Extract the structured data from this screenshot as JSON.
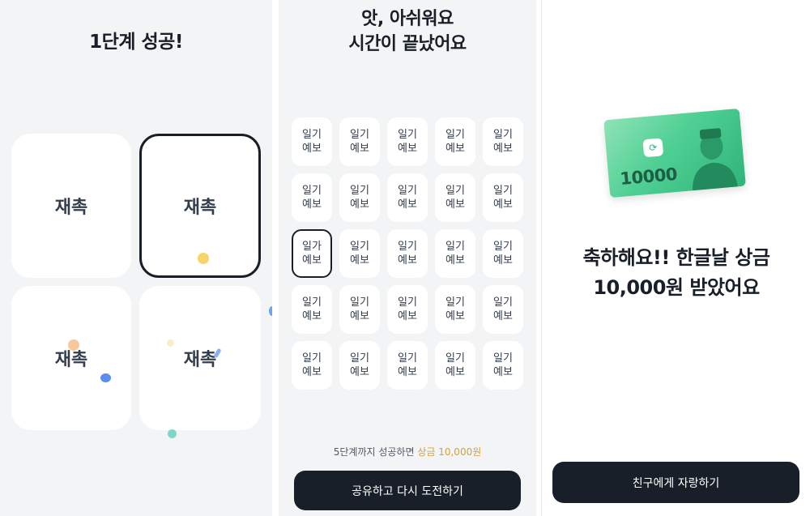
{
  "panel1": {
    "title": "1단계 성공!",
    "cards": [
      "재촉",
      "재촉",
      "재촉",
      "재촉"
    ],
    "selected_index": 1
  },
  "panel2": {
    "title_line1": "앗, 아쉬워요",
    "title_line2": "시간이 끝났어요",
    "grid": [
      [
        "일기",
        "예보"
      ],
      [
        "일기",
        "예보"
      ],
      [
        "일기",
        "예보"
      ],
      [
        "일기",
        "예보"
      ],
      [
        "일기",
        "예보"
      ],
      [
        "일기",
        "예보"
      ],
      [
        "일기",
        "예보"
      ],
      [
        "일기",
        "예보"
      ],
      [
        "일기",
        "예보"
      ],
      [
        "일기",
        "예보"
      ],
      [
        "일가",
        "예보"
      ],
      [
        "일기",
        "예보"
      ],
      [
        "일기",
        "예보"
      ],
      [
        "일기",
        "예보"
      ],
      [
        "일기",
        "예보"
      ],
      [
        "일기",
        "예보"
      ],
      [
        "일기",
        "예보"
      ],
      [
        "일기",
        "예보"
      ],
      [
        "일기",
        "예보"
      ],
      [
        "일기",
        "예보"
      ],
      [
        "일기",
        "예보"
      ],
      [
        "일기",
        "예보"
      ],
      [
        "일기",
        "예보"
      ],
      [
        "일기",
        "예보"
      ],
      [
        "일기",
        "예보"
      ]
    ],
    "selected_index": 10,
    "note_prefix": "5단계까지 성공하면 ",
    "note_highlight": "상금 10,000원",
    "button_label": "공유하고 다시 도전하기"
  },
  "panel3": {
    "bill_amount": "10000",
    "message_line1": "축하해요!! 한글날 상금",
    "message_line2": "10,000원 받았어요",
    "button_label": "친구에게 자랑하기"
  },
  "colors": {
    "accent_dark": "#191f28",
    "highlight_gold": "#d4a237",
    "bill_green": "#4fcf93"
  }
}
